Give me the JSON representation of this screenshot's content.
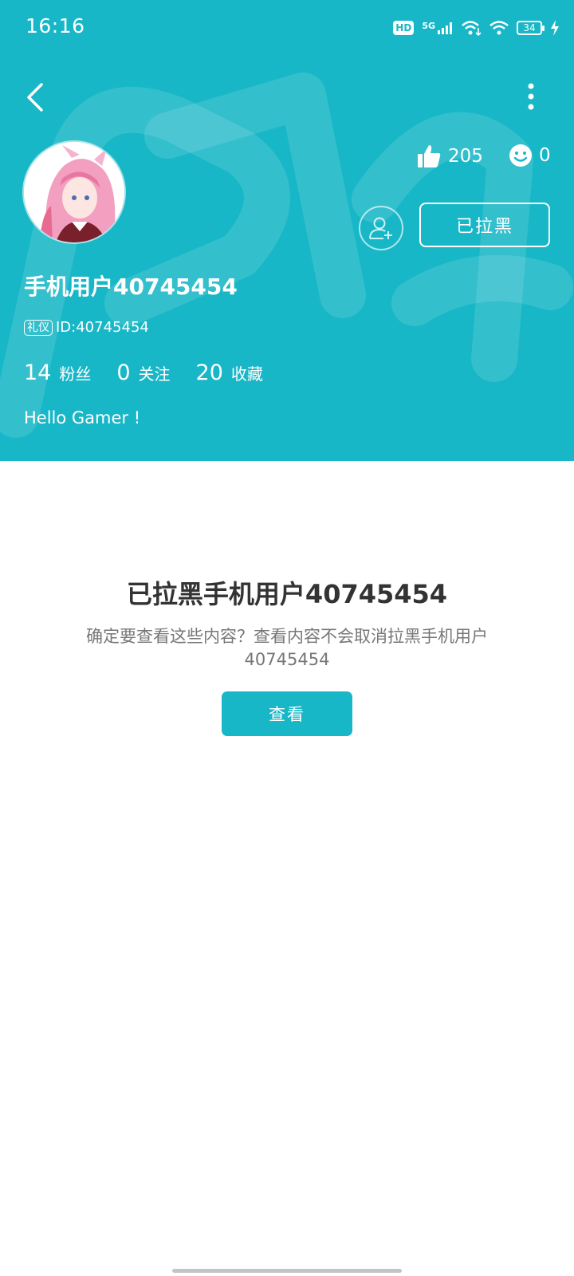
{
  "status_bar": {
    "time": "16:16",
    "hd_label": "HD",
    "network_label": "5G",
    "battery_level": "34",
    "icons": [
      "hd-icon",
      "5g-signal-icon",
      "wifi-arrows-icon",
      "wifi-icon",
      "battery-icon",
      "charging-icon"
    ]
  },
  "toolbar": {
    "back_icon": "chevron-left-icon",
    "more_icon": "more-vertical-icon"
  },
  "profile": {
    "avatar_icon": "avatar-image",
    "likes_count": "205",
    "smiles_count": "0",
    "blocked_label": "已拉黑",
    "username": "手机用户40745454",
    "tag_label": "礼仪",
    "id_text": "ID:40745454",
    "stats": [
      {
        "value": "14",
        "label": "粉丝"
      },
      {
        "value": "0",
        "label": "关注"
      },
      {
        "value": "20",
        "label": "收藏"
      }
    ],
    "bio": "Hello Gamer !"
  },
  "blocked_notice": {
    "title": "已拉黑手机用户40745454",
    "description": "确定要查看这些内容？查看内容不会取消拉黑手机用户40745454",
    "view_label": "查看"
  },
  "colors": {
    "accent": "#18b7c7",
    "title_text": "#333333",
    "desc_text": "#777777"
  }
}
